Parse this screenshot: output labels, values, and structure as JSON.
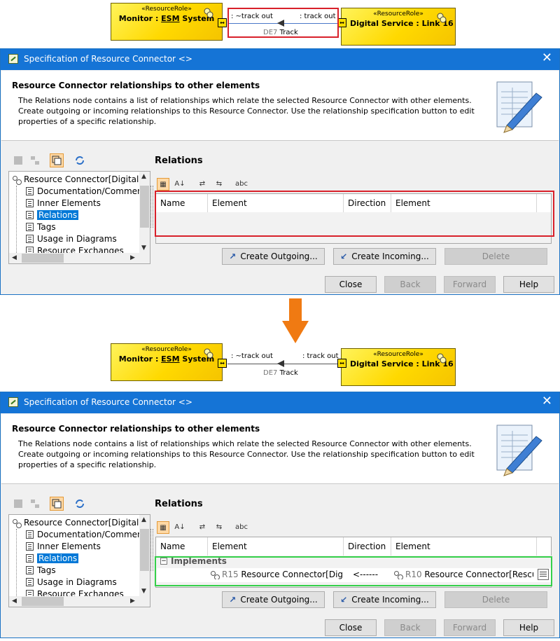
{
  "diagram": {
    "stereotype": "«ResourceRole»",
    "left_role_prefix": "Monitor : ",
    "left_role_type": "ESM",
    "left_role_suffix": " System",
    "right_role": "Digital Service : Link 16",
    "left_end_label": ": ~track out",
    "right_end_label": ": track out",
    "flow_id": "DE7",
    "flow_name": " Track"
  },
  "dialog": {
    "title": "Specification of Resource Connector <>",
    "close_glyph": "✕",
    "header_title": "Resource Connector relationships to other elements",
    "header_desc": "The Relations node contains a list of relationships which relate the selected Resource Connector with other elements. Create outgoing or incoming relationships to this Resource Connector. Use the relationship specification button to edit properties of a specific relationship.",
    "tree": {
      "root": "Resource Connector[Digital Ser",
      "items": [
        "Documentation/Comment",
        "Inner Elements",
        "Relations",
        "Tags",
        "Usage in Diagrams",
        "Resource Exchanges"
      ],
      "selected": "Relations"
    },
    "panel_title": "Relations",
    "toolbar_mini": [
      "▦",
      "A↓",
      "⇄",
      "⇆",
      "abc"
    ],
    "columns": [
      "Name",
      "Element",
      "Direction",
      "Element"
    ],
    "group_label": "Implements",
    "group_toggle": "−",
    "row": {
      "id1": "R15",
      "element1": " Resource Connector[Digit...",
      "direction": "<------",
      "id2": "R10",
      "element2": " Resource Connector[Rescue ..."
    },
    "buttons": {
      "create_outgoing": "Create Outgoing...",
      "create_incoming": "Create Incoming...",
      "delete": "Delete",
      "close": "Close",
      "back": "Back",
      "forward": "Forward",
      "help": "Help"
    }
  },
  "colors": {
    "title_bar": "#1574d6",
    "highlight_before": "#d8202a",
    "highlight_after": "#35d04a",
    "arrow": "#f07a12"
  }
}
